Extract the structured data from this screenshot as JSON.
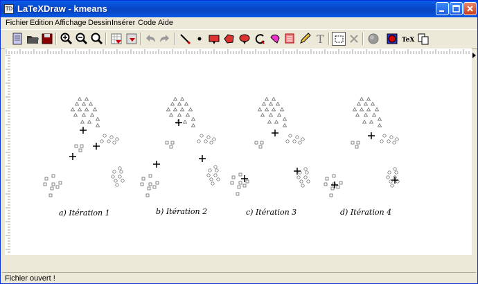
{
  "window": {
    "title": "LaTeXDraw - kmeans"
  },
  "menu": [
    "Fichier",
    "Edition",
    "Affichage",
    "Dessin",
    "Insérer",
    "Code",
    "Aide"
  ],
  "toolbar": {
    "icons": [
      "new-document-icon",
      "open-folder-icon",
      "save-icon",
      "zoom-in-icon",
      "zoom-out-icon",
      "zoom-fit-icon",
      "grid-icon",
      "magnetic-grid-icon",
      "undo-icon",
      "redo-icon",
      "pen-icon",
      "dot-icon",
      "rectangle-icon",
      "polygon-icon",
      "ellipse-icon",
      "arc-icon",
      "bezier-icon",
      "text-frame-icon",
      "pencil-icon",
      "text-icon",
      "selection-icon",
      "delete-icon",
      "shadow-icon",
      "color-icon",
      "tex-icon",
      "copy-icon"
    ],
    "tex_label": "TeX",
    "text_label": "T"
  },
  "captions": [
    "a) Itération 1",
    "b) Itération 2",
    "c) Itération 3",
    "d) Itération 4"
  ],
  "status": "Fichier ouvert !"
}
